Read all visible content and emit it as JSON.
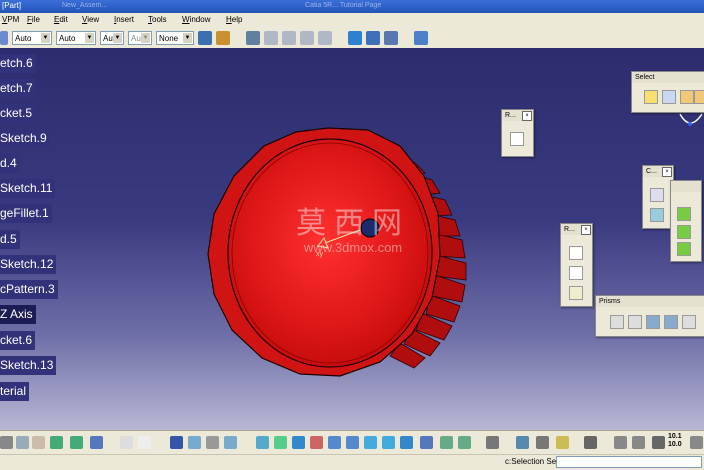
{
  "window": {
    "title": "[Part]",
    "ghost_titles": [
      "New_Assem...",
      "Catia 5R... Tutorial Page"
    ]
  },
  "menu": [
    "VPM",
    "File",
    "Edit",
    "View",
    "Insert",
    "Tools",
    "Window",
    "Help"
  ],
  "toolbar": {
    "combos": [
      {
        "name": "combo-1",
        "value": "Auto"
      },
      {
        "name": "combo-2",
        "value": "Auto"
      },
      {
        "name": "combo-3",
        "value": "Aut"
      },
      {
        "name": "combo-4",
        "value": "Aut"
      },
      {
        "name": "combo-5",
        "value": "None"
      }
    ]
  },
  "tree": {
    "items": [
      {
        "label": "etch.6"
      },
      {
        "label": "etch.7"
      },
      {
        "label": "cket.5"
      },
      {
        "label": "Sketch.9"
      },
      {
        "label": "d.4"
      },
      {
        "label": "Sketch.11"
      },
      {
        "label": "geFillet.1"
      },
      {
        "label": "d.5"
      },
      {
        "label": "Sketch.12"
      },
      {
        "label": "cPattern.3"
      },
      {
        "label": "Z Axis"
      },
      {
        "label": "cket.6"
      },
      {
        "label": "Sketch.13"
      },
      {
        "label": "terial"
      }
    ]
  },
  "watermark": {
    "cn": "莫西网",
    "url": "www.3dmox.com"
  },
  "panels": {
    "select": {
      "title": "Select"
    },
    "r1": {
      "title": "R..."
    },
    "r2": {
      "title": "R..."
    },
    "c": {
      "title": "C..."
    },
    "prisms": {
      "title": "Prisms"
    }
  },
  "model": {
    "color": "#cc1010",
    "dark": "#7a0505"
  },
  "status": {
    "text": "c:Selection Sets Edition",
    "input": ""
  },
  "coords": {
    "a": "10.1",
    "b": "10.0"
  }
}
